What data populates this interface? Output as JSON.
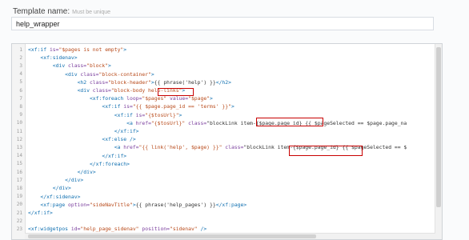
{
  "form": {
    "label": "Template name:",
    "hint": "Must be unique",
    "value": "help_wrapper"
  },
  "editor": {
    "lines": [
      {
        "n": "1",
        "text": "<xf:if is=\"$pages is not empty\">"
      },
      {
        "n": "2",
        "text": "    <xf:sidenav>"
      },
      {
        "n": "3",
        "text": "        <div class=\"block\">"
      },
      {
        "n": "4",
        "text": "            <div class=\"block-container\">"
      },
      {
        "n": "5",
        "text": "                <h2 class=\"block-header\">{{ phrase('help') }}</h2>"
      },
      {
        "n": "6",
        "text": "                <div class=\"block-body help-links\">"
      },
      {
        "n": "7",
        "text": "                    <xf:foreach loop=\"$pages\" value=\"$page\">"
      },
      {
        "n": "8",
        "text": "                        <xf:if is=\"{{ $page.page_id == 'terms' }}\">"
      },
      {
        "n": "9",
        "text": "                            <xf:if is=\"{$tosUrl}\">"
      },
      {
        "n": "10",
        "text": "                                <a href=\"{$tosUrl}\" class=\"blockLink item-{$page.page_id} {{ $pageSelected == $page.page_na"
      },
      {
        "n": "11",
        "text": "                            </xf:if>"
      },
      {
        "n": "12",
        "text": "                        <xf:else />"
      },
      {
        "n": "13",
        "text": "                            <a href=\"{{ link('help', $page) }}\" class=\"blockLink item-{$page.page_id} {{ $pageSelected == $"
      },
      {
        "n": "14",
        "text": "                        </xf:if>"
      },
      {
        "n": "15",
        "text": "                    </xf:foreach>"
      },
      {
        "n": "16",
        "text": "                </div>"
      },
      {
        "n": "17",
        "text": "            </div>"
      },
      {
        "n": "18",
        "text": "        </div>"
      },
      {
        "n": "19",
        "text": "    </xf:sidenav>"
      },
      {
        "n": "20",
        "text": "    <xf:page option=\"sideNavTitle\">{{ phrase('help_pages') }}</xf:page>"
      },
      {
        "n": "21",
        "text": "</xf:if>"
      },
      {
        "n": "22",
        "text": ""
      },
      {
        "n": "23",
        "text": "<xf:widgetpos id=\"help_page_sidenav\" position=\"sidenav\" />"
      }
    ]
  }
}
